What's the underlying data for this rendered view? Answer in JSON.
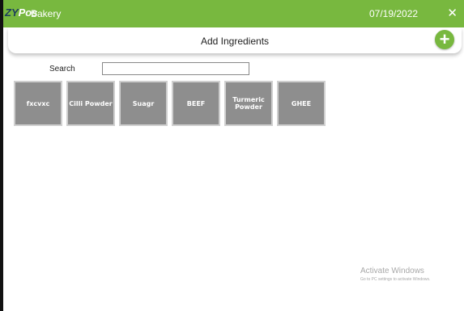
{
  "titlebar": {
    "logo_zy": "ZY",
    "logo_pos": "Pos",
    "app_name": "Bakery",
    "date": "07/19/2022",
    "close_glyph": "✕"
  },
  "header": {
    "title": "Add Ingredients",
    "add_glyph": "+"
  },
  "search": {
    "label": "Search",
    "value": ""
  },
  "ingredients": [
    {
      "label": "fxcvxc"
    },
    {
      "label": "Cilli Powder"
    },
    {
      "label": "Suagr"
    },
    {
      "label": "BEEF"
    },
    {
      "label": "Turmeric Powder"
    },
    {
      "label": "GHEE"
    }
  ],
  "watermark": {
    "title": "Activate Windows",
    "subtitle": "Go to PC settings to activate Windows."
  },
  "colors": {
    "accent": "#78b83f",
    "tile": "#8e8e8e"
  }
}
